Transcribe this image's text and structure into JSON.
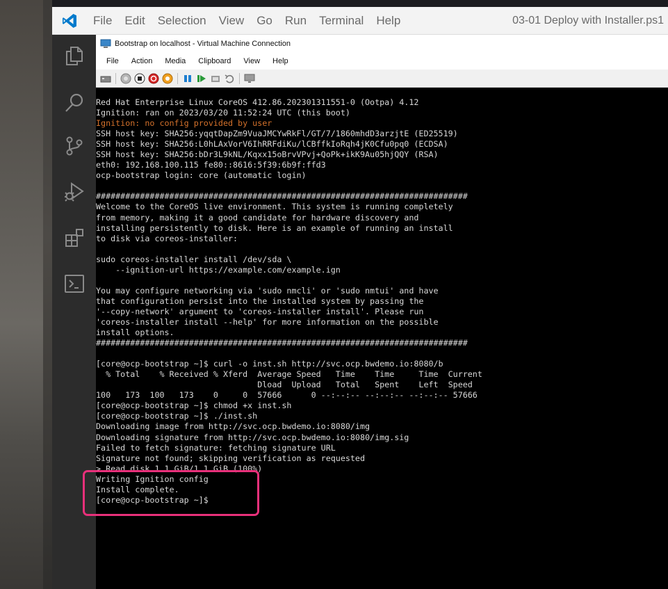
{
  "vscode": {
    "menu": [
      "File",
      "Edit",
      "Selection",
      "View",
      "Go",
      "Run",
      "Terminal",
      "Help"
    ],
    "title": "03-01 Deploy with Installer.ps1",
    "accent": "#007acc",
    "activity_icons": [
      "files-icon",
      "search-icon",
      "source-control-icon",
      "run-debug-icon",
      "extensions-icon",
      "terminal-icon"
    ]
  },
  "vm": {
    "title": "Bootstrap on localhost - Virtual Machine Connection",
    "menu": [
      "File",
      "Action",
      "Media",
      "Clipboard",
      "View",
      "Help"
    ]
  },
  "terminal": {
    "lines": [
      "Red Hat Enterprise Linux CoreOS 412.86.202301311551-0 (Ootpa) 4.12",
      "Ignition: ran on 2023/03/20 11:52:24 UTC (this boot)",
      "Ignition: no config provided by user",
      "SSH host key: SHA256:yqqtDapZm9VuaJMCYwRkFl/GT/7/1860mhdD3arzjtE (ED25519)",
      "SSH host key: SHA256:L0hLAxVorV6IhRRFdiKu/lCBffkIoRqh4jK0Cfu0pq0 (ECDSA)",
      "SSH host key: SHA256:bDr3L9kNL/Kqxx15oBrvVPvj+QoPk+ikK9Au05hjQQY (RSA)",
      "eth0: 192.168.100.115 fe80::8616:5f39:6b9f:ffd3",
      "ocp-bootstrap login: core (automatic login)",
      "",
      "############################################################################",
      "Welcome to the CoreOS live environment. This system is running completely",
      "from memory, making it a good candidate for hardware discovery and",
      "installing persistently to disk. Here is an example of running an install",
      "to disk via coreos-installer:",
      "",
      "sudo coreos-installer install /dev/sda \\",
      "    --ignition-url https://example.com/example.ign",
      "",
      "You may configure networking via 'sudo nmcli' or 'sudo nmtui' and have",
      "that configuration persist into the installed system by passing the",
      "'--copy-network' argument to 'coreos-installer install'. Please run",
      "'coreos-installer install --help' for more information on the possible",
      "install options.",
      "############################################################################",
      "",
      "[core@ocp-bootstrap ~]$ curl -o inst.sh http://svc.ocp.bwdemo.io:8080/b",
      "  % Total    % Received % Xferd  Average Speed   Time    Time     Time  Current",
      "                                 Dload  Upload   Total   Spent    Left  Speed",
      "100   173  100   173    0     0  57666      0 --:--:-- --:--:-- --:--:-- 57666",
      "[core@ocp-bootstrap ~]$ chmod +x inst.sh",
      "[core@ocp-bootstrap ~]$ ./inst.sh",
      "Downloading image from http://svc.ocp.bwdemo.io:8080/img",
      "Downloading signature from http://svc.ocp.bwdemo.io:8080/img.sig",
      "Failed to fetch signature: fetching signature URL",
      "Signature not found; skipping verification as requested",
      "> Read disk 1.1 GiB/1.1 GiB (100%)",
      "Writing Ignition config",
      "Install complete.",
      "[core@ocp-bootstrap ~]$"
    ],
    "warn_line_index": 2,
    "text_color": "#d8d8d8",
    "warn_color": "#d4712b",
    "highlight_color": "#e8307a"
  }
}
